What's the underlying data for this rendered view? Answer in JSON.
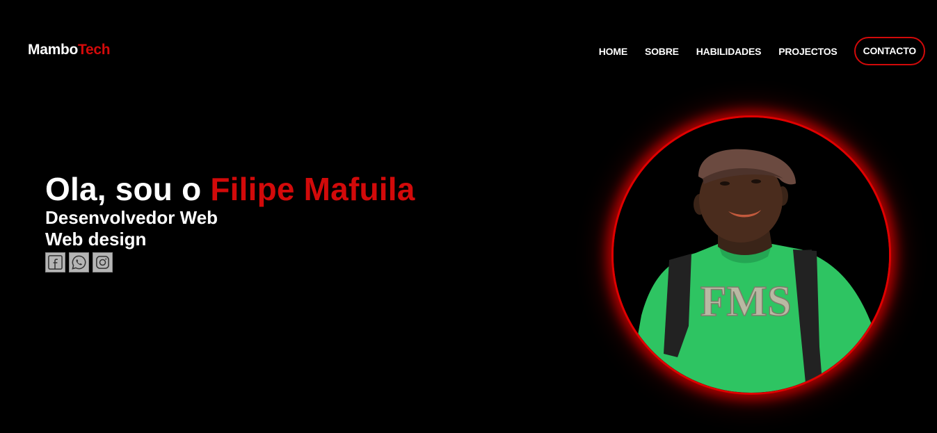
{
  "brand": {
    "main": "Mambo",
    "accent": "Tech"
  },
  "nav": {
    "items": [
      "HOME",
      "SOBRE",
      "HABILIDADES",
      "PROJECTOS"
    ],
    "contact": "CONTACTO"
  },
  "hero": {
    "greeting": "Ola, sou o",
    "name": "Filipe Mafuila",
    "roles": [
      "Desenvolvedor Web",
      "Web design"
    ]
  },
  "socials": [
    {
      "icon": "facebook-icon"
    },
    {
      "icon": "whatsapp-icon"
    },
    {
      "icon": "instagram-icon"
    }
  ],
  "portrait": {
    "shirt_text": "FMS"
  },
  "colors": {
    "background": "#000000",
    "accent": "#d20a0a",
    "text": "#ffffff",
    "shirt": "#2ec462"
  }
}
